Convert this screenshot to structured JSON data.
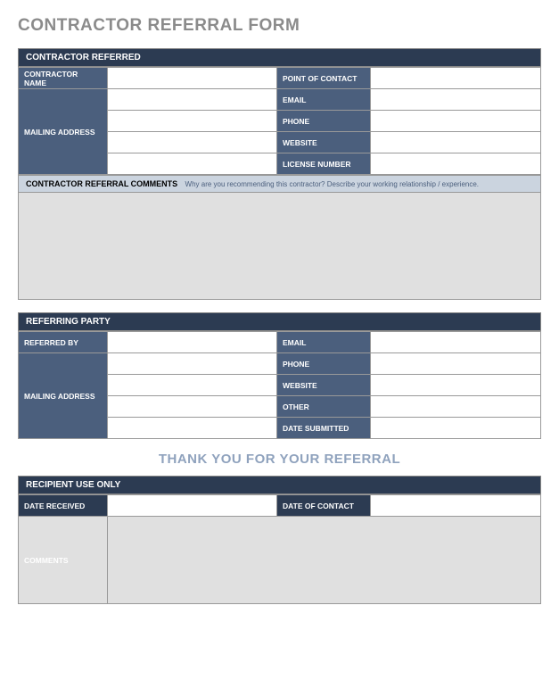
{
  "title": "CONTRACTOR REFERRAL FORM",
  "section1": {
    "header": "CONTRACTOR REFERRED",
    "contractor_name_label": "CONTRACTOR NAME",
    "mailing_address_label": "MAILING ADDRESS",
    "poc_label": "POINT OF CONTACT",
    "email_label": "EMAIL",
    "phone_label": "PHONE",
    "website_label": "WEBSITE",
    "license_label": "LICENSE NUMBER",
    "comments_label": "CONTRACTOR REFERRAL COMMENTS",
    "comments_instr": "Why are you recommending this contractor? Describe your working relationship / experience."
  },
  "section2": {
    "header": "REFERRING PARTY",
    "referred_by_label": "REFERRED BY",
    "mailing_address_label": "MAILING ADDRESS",
    "email_label": "EMAIL",
    "phone_label": "PHONE",
    "website_label": "WEBSITE",
    "other_label": "OTHER",
    "date_submitted_label": "DATE SUBMITTED"
  },
  "thankyou": "THANK YOU FOR YOUR REFERRAL",
  "section3": {
    "header": "RECIPIENT USE ONLY",
    "date_received_label": "DATE RECEIVED",
    "date_contact_label": "DATE OF CONTACT",
    "comments_label": "COMMENTS"
  }
}
